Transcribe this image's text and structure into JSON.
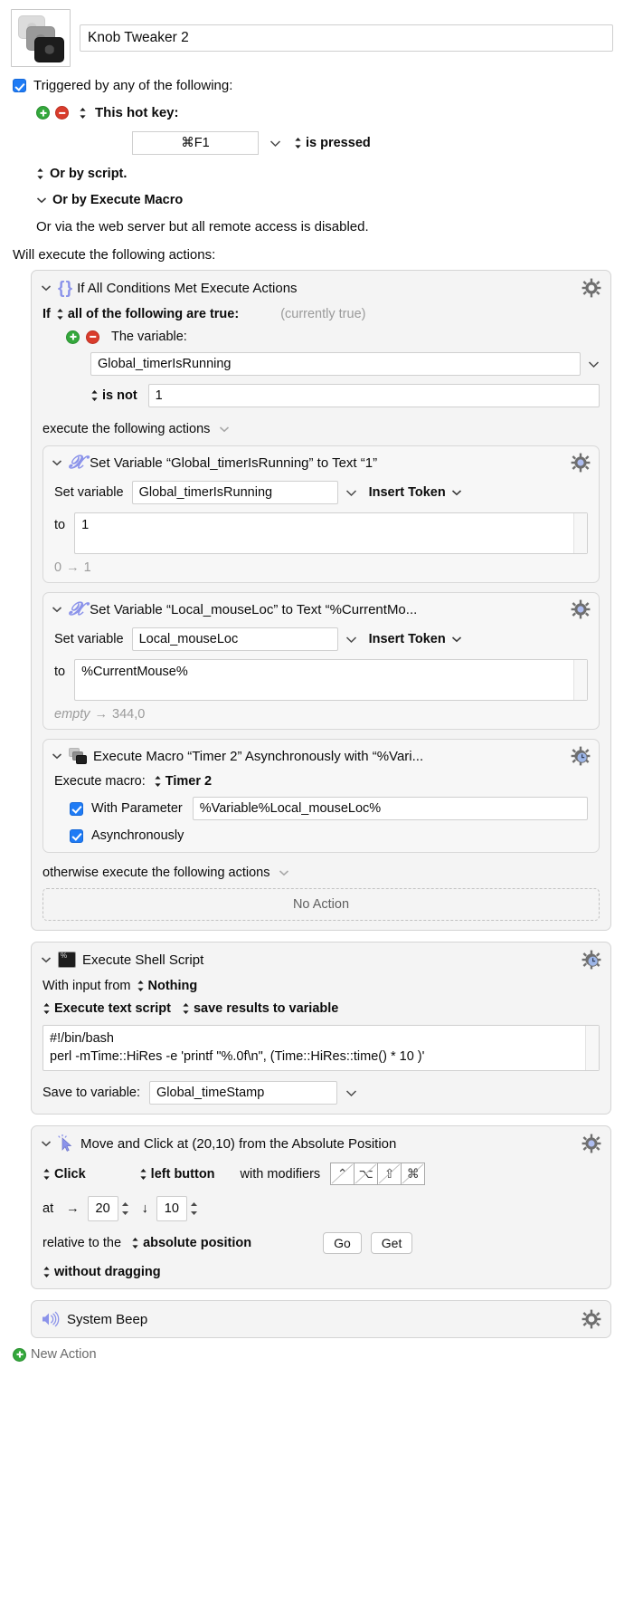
{
  "macro": {
    "icon_name": "macro-stack-icon",
    "name_value": "Knob Tweaker 2"
  },
  "triggers": {
    "enabled_label": "Triggered by any of the following:",
    "hotkey_label": "This hot key:",
    "hotkey_value": "⌘F1",
    "hotkey_condition": "is pressed",
    "or_by_script": "Or by script.",
    "or_by_execute_macro": "Or by Execute Macro",
    "web_server_note": "Or via the web server but all remote access is disabled."
  },
  "will_execute_label": "Will execute the following actions:",
  "actions": {
    "if_block": {
      "title": "If All Conditions Met Execute Actions",
      "if_word": "If",
      "condition_mode": "all of the following are true:",
      "currently": "(currently true)",
      "the_variable_label": "The variable:",
      "variable_name": "Global_timerIsRunning",
      "operator": "is not",
      "operand": "1",
      "then_label": "execute the following actions",
      "otherwise_label": "otherwise execute the following actions",
      "no_action_label": "No Action",
      "then_actions": [
        {
          "title": "Set Variable “Global_timerIsRunning” to Text “1”",
          "set_variable_label": "Set variable",
          "variable": "Global_timerIsRunning",
          "insert_token": "Insert Token",
          "to_label": "to",
          "value": "1",
          "before": "0",
          "arrow": "→",
          "after": "1"
        },
        {
          "title": "Set Variable “Local_mouseLoc” to Text “%CurrentMo...",
          "set_variable_label": "Set variable",
          "variable": "Local_mouseLoc",
          "insert_token": "Insert Token",
          "to_label": "to",
          "value": "%CurrentMouse%",
          "before": "empty",
          "arrow": "→",
          "after": "344,0"
        },
        {
          "title": "Execute Macro “Timer 2” Asynchronously with “%Vari...",
          "execute_macro_label": "Execute macro:",
          "macro_name": "Timer 2",
          "with_parameter_label": "With Parameter",
          "with_parameter_checked": true,
          "parameter_value": "%Variable%Local_mouseLoc%",
          "asynchronously_label": "Asynchronously",
          "asynchronously_checked": true
        }
      ]
    },
    "shell": {
      "title": "Execute Shell Script",
      "with_input_label": "With input from",
      "with_input_value": "Nothing",
      "execute_mode": "Execute text script",
      "results_mode": "save results to variable",
      "script_line1": "#!/bin/bash",
      "script_line2": "perl -mTime::HiRes -e 'printf \"%.0f\\n\", (Time::HiRes::time() * 10 )'",
      "save_to_label": "Save to variable:",
      "save_to_variable": "Global_timeStamp"
    },
    "click": {
      "title": "Move and Click at (20,10) from the Absolute Position",
      "action_mode": "Click",
      "button_mode": "left button",
      "modifiers_label": "with modifiers",
      "modifiers": [
        "⌃",
        "⌥",
        "⇧",
        "⌘"
      ],
      "at_label": "at",
      "x_arrow": "→",
      "x_value": "20",
      "y_arrow": "↓",
      "y_value": "10",
      "relative_label": "relative to the",
      "relative_value": "absolute position",
      "go_button": "Go",
      "get_button": "Get",
      "drag_mode": "without dragging"
    },
    "beep": {
      "title": "System Beep"
    }
  },
  "new_action_label": "New Action",
  "colors": {
    "accent_blue": "#1e7bf5",
    "icon_purple": "#8b93ea",
    "add_green": "#34a83c",
    "remove_red": "#d93c2c",
    "card_bg": "#f4f4f4",
    "muted_grey": "#9b9b9b"
  }
}
